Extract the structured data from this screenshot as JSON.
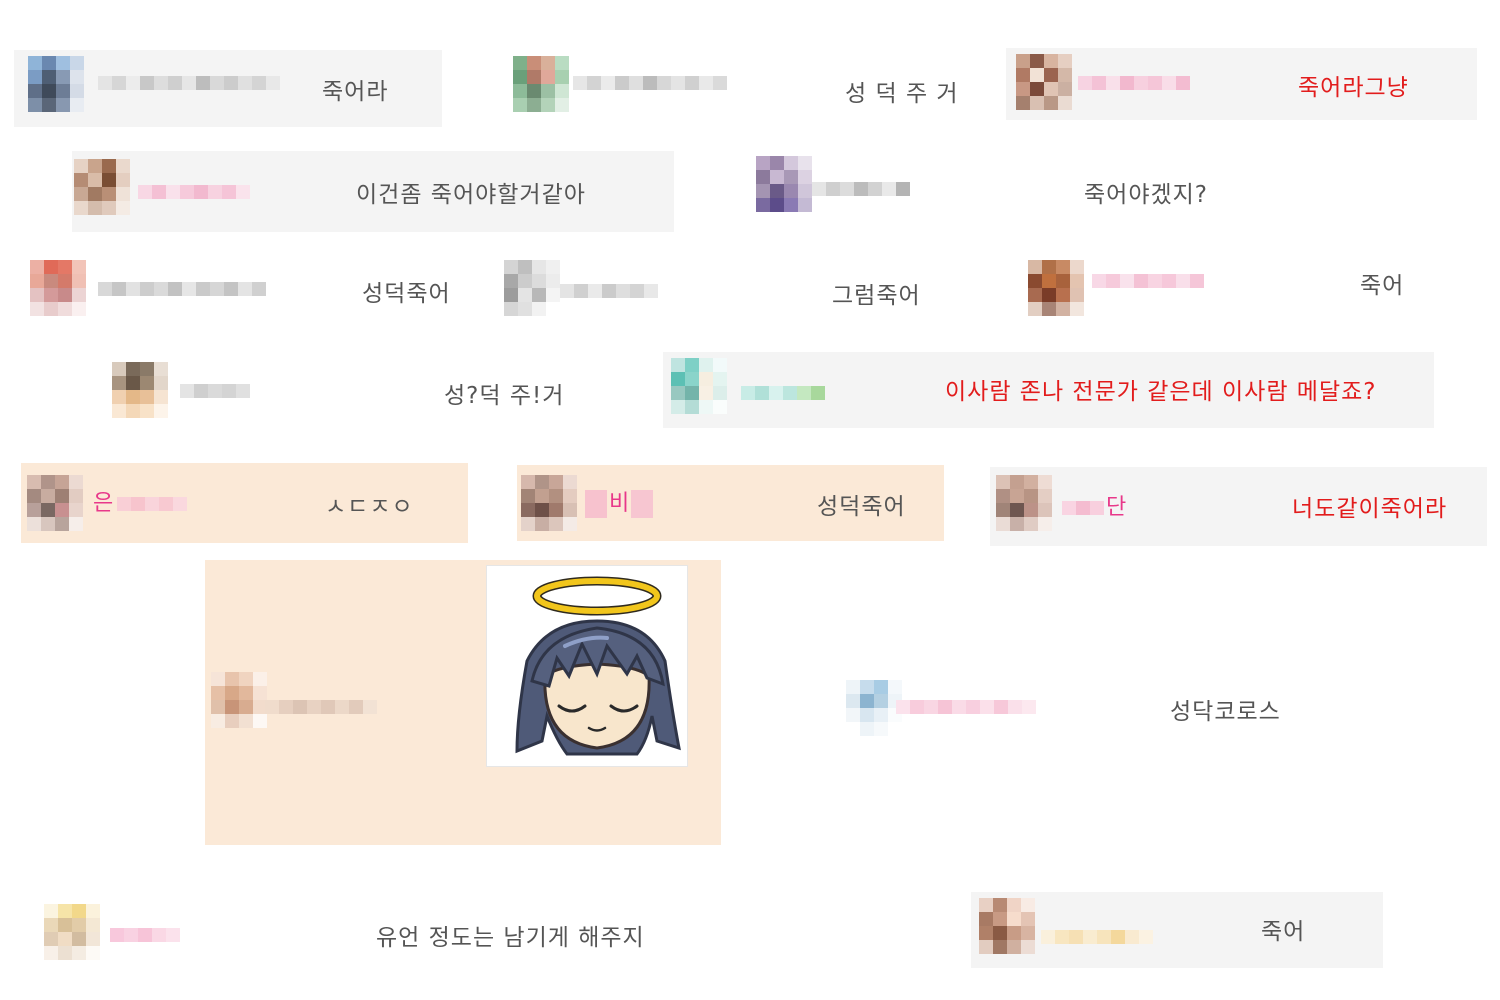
{
  "colors": {
    "bubble_gray": "#f4f4f4",
    "bubble_peach": "#fbe9d7",
    "text_default": "#555555",
    "text_red": "#e21c1c",
    "text_pink": "#e8388a"
  },
  "chat": {
    "messages": [
      {
        "text": "죽어라"
      },
      {
        "text": "성 덕 주 거"
      },
      {
        "text": "죽어라그냥"
      },
      {
        "text": "이건좀 죽어야할거같아"
      },
      {
        "text": "죽어야겠지?"
      },
      {
        "text": "성덕죽어"
      },
      {
        "text": "그럼죽어"
      },
      {
        "text": "죽어"
      },
      {
        "text": "성?덕 주!거"
      },
      {
        "text": "이사람 존나 전문가 같은데 이사람 메달죠?"
      },
      {
        "text": "ㅅㄷㅈㅇ",
        "nick_fragment": "은"
      },
      {
        "text": "성덕죽어",
        "nick_fragment": "비"
      },
      {
        "text": "너도같이죽어라",
        "nick_fragment": "단"
      },
      {
        "text": "성닥코로스"
      },
      {
        "text": "유언 정도는 남기게 해주지"
      },
      {
        "text": "죽어"
      }
    ],
    "sticker": {
      "icon": "angel-halo-sticker-icon"
    }
  }
}
